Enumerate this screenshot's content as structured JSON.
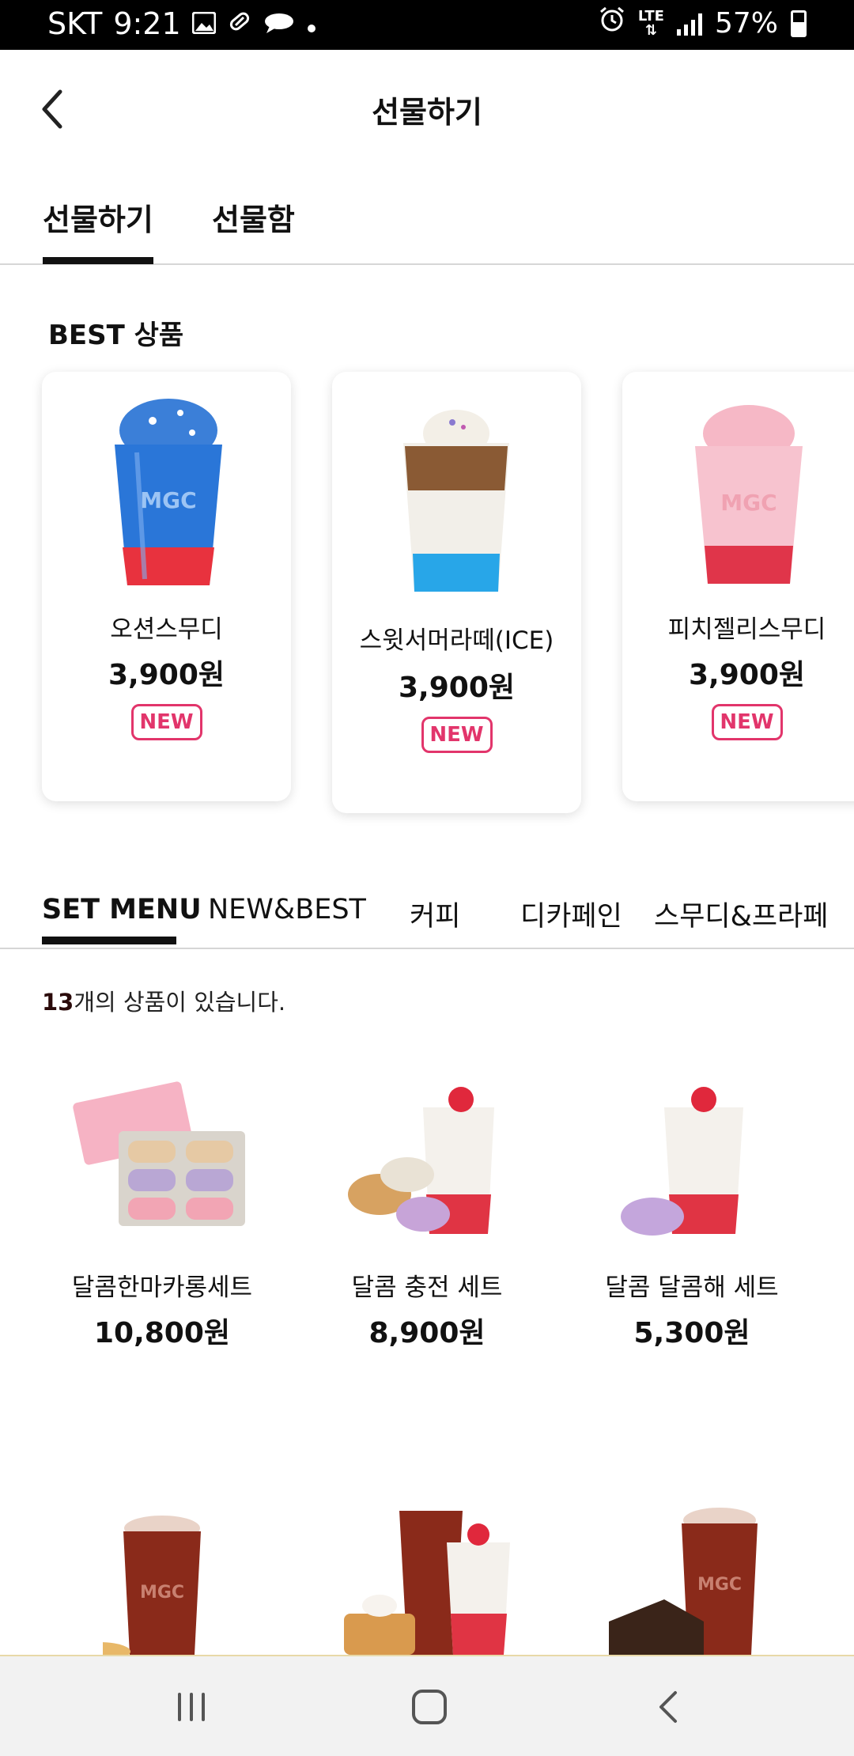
{
  "status_bar": {
    "carrier": "SKT",
    "time": "9:21",
    "network": "LTE",
    "battery": "57%"
  },
  "header": {
    "title": "선물하기"
  },
  "top_tabs": [
    {
      "label": "선물하기",
      "active": true
    },
    {
      "label": "선물함",
      "active": false
    }
  ],
  "best": {
    "title": "BEST 상품",
    "items": [
      {
        "name": "오션스무디",
        "price": "3,900원",
        "badge": "NEW"
      },
      {
        "name": "스윗서머라떼(ICE)",
        "price": "3,900원",
        "badge": "NEW"
      },
      {
        "name": "피치젤리스무디",
        "price": "3,900원",
        "badge": "NEW"
      }
    ]
  },
  "category_tabs": [
    {
      "label": "SET MENU",
      "active": true
    },
    {
      "label": "NEW&BEST",
      "active": false
    },
    {
      "label": "커피",
      "active": false
    },
    {
      "label": "디카페인",
      "active": false
    },
    {
      "label": "스무디&프라페",
      "active": false
    }
  ],
  "listing": {
    "count": "13",
    "count_suffix": "개의 상품이 있습니다."
  },
  "products": [
    {
      "name": "달콤한마카롱세트",
      "price": "10,800원"
    },
    {
      "name": "달콤 충전 세트",
      "price": "8,900원"
    },
    {
      "name": "달콤 달콤해 세트",
      "price": "5,300원"
    }
  ],
  "colors": {
    "accent": "#e2356b",
    "ocean_blue": "#2a76d8",
    "pink": "#f4a6b8",
    "iced_tea": "#8a2a1a"
  },
  "icons": {
    "back": "chevron-left-icon",
    "nav_recent": "recent-apps-icon",
    "nav_home": "home-icon",
    "nav_back": "back-icon"
  }
}
